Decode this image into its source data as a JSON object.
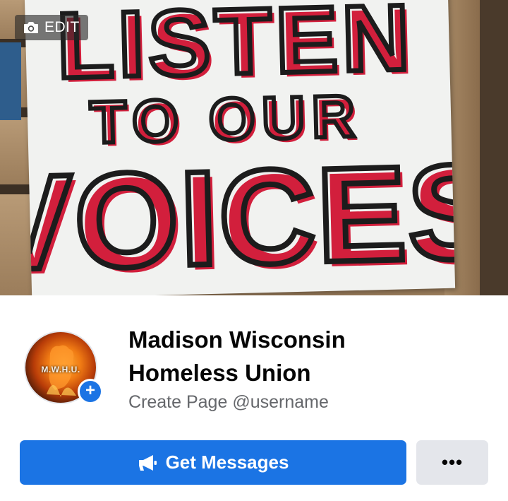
{
  "cover": {
    "edit_label": "EDIT",
    "sign_lines": [
      "LISTEN",
      "TO OUR",
      "VOICES"
    ]
  },
  "profile": {
    "avatar_text": "M.W.H.U.",
    "title_line1": "Madison Wisconsin",
    "title_line2": "Homeless Union",
    "subtitle": "Create Page @username"
  },
  "actions": {
    "primary_label": "Get Messages",
    "more_label": "•••"
  },
  "icons": {
    "camera": "camera-icon",
    "megaphone": "megaphone-icon",
    "plus": "plus-icon"
  },
  "colors": {
    "primary": "#1b74e4",
    "secondary_button": "#e4e6eb",
    "sign_red": "#d21f3c",
    "sign_black": "#1c1c1c"
  }
}
